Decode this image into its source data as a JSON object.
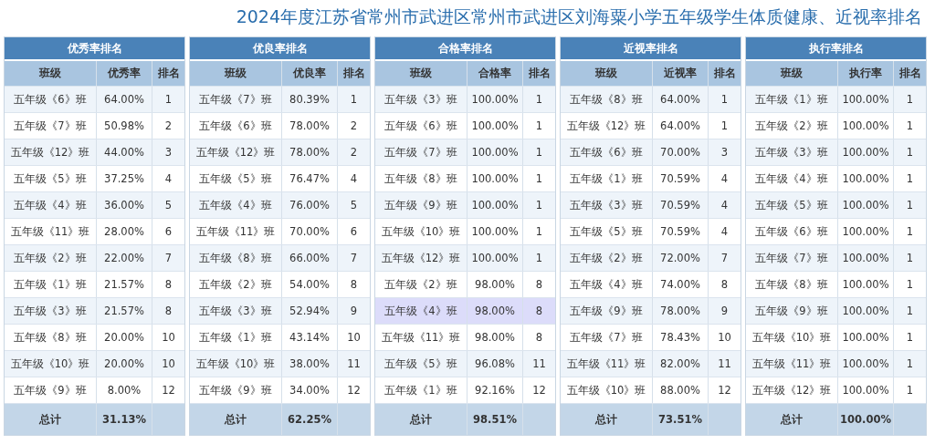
{
  "title": "2024年度江苏省常州市武进区常州市武进区刘海粟小学五年级学生体质健康、近视率排名",
  "tables": [
    {
      "title": "优秀率排名",
      "columns": [
        "班级",
        "优秀率",
        "排名"
      ],
      "rows": [
        {
          "class": "五年级《6》班",
          "rate": "64.00%",
          "rank": "1",
          "selected": false
        },
        {
          "class": "五年级《7》班",
          "rate": "50.98%",
          "rank": "2",
          "selected": false
        },
        {
          "class": "五年级《12》班",
          "rate": "44.00%",
          "rank": "3",
          "selected": false
        },
        {
          "class": "五年级《5》班",
          "rate": "37.25%",
          "rank": "4",
          "selected": false
        },
        {
          "class": "五年级《4》班",
          "rate": "36.00%",
          "rank": "5",
          "selected": false
        },
        {
          "class": "五年级《11》班",
          "rate": "28.00%",
          "rank": "6",
          "selected": false
        },
        {
          "class": "五年级《2》班",
          "rate": "22.00%",
          "rank": "7",
          "selected": false
        },
        {
          "class": "五年级《1》班",
          "rate": "21.57%",
          "rank": "8",
          "selected": false
        },
        {
          "class": "五年级《3》班",
          "rate": "21.57%",
          "rank": "8",
          "selected": false
        },
        {
          "class": "五年级《8》班",
          "rate": "20.00%",
          "rank": "10",
          "selected": false
        },
        {
          "class": "五年级《10》班",
          "rate": "20.00%",
          "rank": "10",
          "selected": false
        },
        {
          "class": "五年级《9》班",
          "rate": "8.00%",
          "rank": "12",
          "selected": false
        }
      ],
      "total": {
        "label": "总计",
        "value": "31.13%"
      }
    },
    {
      "title": "优良率排名",
      "columns": [
        "班级",
        "优良率",
        "排名"
      ],
      "rows": [
        {
          "class": "五年级《7》班",
          "rate": "80.39%",
          "rank": "1",
          "selected": false
        },
        {
          "class": "五年级《6》班",
          "rate": "78.00%",
          "rank": "2",
          "selected": false
        },
        {
          "class": "五年级《12》班",
          "rate": "78.00%",
          "rank": "2",
          "selected": false
        },
        {
          "class": "五年级《5》班",
          "rate": "76.47%",
          "rank": "4",
          "selected": false
        },
        {
          "class": "五年级《4》班",
          "rate": "76.00%",
          "rank": "5",
          "selected": false
        },
        {
          "class": "五年级《11》班",
          "rate": "70.00%",
          "rank": "6",
          "selected": false
        },
        {
          "class": "五年级《8》班",
          "rate": "66.00%",
          "rank": "7",
          "selected": false
        },
        {
          "class": "五年级《2》班",
          "rate": "54.00%",
          "rank": "8",
          "selected": false
        },
        {
          "class": "五年级《3》班",
          "rate": "52.94%",
          "rank": "9",
          "selected": false
        },
        {
          "class": "五年级《1》班",
          "rate": "43.14%",
          "rank": "10",
          "selected": false
        },
        {
          "class": "五年级《10》班",
          "rate": "38.00%",
          "rank": "11",
          "selected": false
        },
        {
          "class": "五年级《9》班",
          "rate": "34.00%",
          "rank": "12",
          "selected": false
        }
      ],
      "total": {
        "label": "总计",
        "value": "62.25%"
      }
    },
    {
      "title": "合格率排名",
      "columns": [
        "班级",
        "合格率",
        "排名"
      ],
      "rows": [
        {
          "class": "五年级《3》班",
          "rate": "100.00%",
          "rank": "1",
          "selected": false
        },
        {
          "class": "五年级《6》班",
          "rate": "100.00%",
          "rank": "1",
          "selected": false
        },
        {
          "class": "五年级《7》班",
          "rate": "100.00%",
          "rank": "1",
          "selected": false
        },
        {
          "class": "五年级《8》班",
          "rate": "100.00%",
          "rank": "1",
          "selected": false
        },
        {
          "class": "五年级《9》班",
          "rate": "100.00%",
          "rank": "1",
          "selected": false
        },
        {
          "class": "五年级《10》班",
          "rate": "100.00%",
          "rank": "1",
          "selected": false
        },
        {
          "class": "五年级《12》班",
          "rate": "100.00%",
          "rank": "1",
          "selected": false
        },
        {
          "class": "五年级《2》班",
          "rate": "98.00%",
          "rank": "8",
          "selected": false
        },
        {
          "class": "五年级《4》班",
          "rate": "98.00%",
          "rank": "8",
          "selected": true
        },
        {
          "class": "五年级《11》班",
          "rate": "98.00%",
          "rank": "8",
          "selected": false
        },
        {
          "class": "五年级《5》班",
          "rate": "96.08%",
          "rank": "11",
          "selected": false
        },
        {
          "class": "五年级《1》班",
          "rate": "92.16%",
          "rank": "12",
          "selected": false
        }
      ],
      "total": {
        "label": "总计",
        "value": "98.51%"
      }
    },
    {
      "title": "近视率排名",
      "columns": [
        "班级",
        "近视率",
        "排名"
      ],
      "rows": [
        {
          "class": "五年级《8》班",
          "rate": "64.00%",
          "rank": "1",
          "selected": false
        },
        {
          "class": "五年级《12》班",
          "rate": "64.00%",
          "rank": "1",
          "selected": false
        },
        {
          "class": "五年级《6》班",
          "rate": "70.00%",
          "rank": "3",
          "selected": false
        },
        {
          "class": "五年级《1》班",
          "rate": "70.59%",
          "rank": "4",
          "selected": false
        },
        {
          "class": "五年级《3》班",
          "rate": "70.59%",
          "rank": "4",
          "selected": false
        },
        {
          "class": "五年级《5》班",
          "rate": "70.59%",
          "rank": "4",
          "selected": false
        },
        {
          "class": "五年级《2》班",
          "rate": "72.00%",
          "rank": "7",
          "selected": false
        },
        {
          "class": "五年级《4》班",
          "rate": "74.00%",
          "rank": "8",
          "selected": false
        },
        {
          "class": "五年级《9》班",
          "rate": "78.00%",
          "rank": "9",
          "selected": false
        },
        {
          "class": "五年级《7》班",
          "rate": "78.43%",
          "rank": "10",
          "selected": false
        },
        {
          "class": "五年级《11》班",
          "rate": "82.00%",
          "rank": "11",
          "selected": false
        },
        {
          "class": "五年级《10》班",
          "rate": "88.00%",
          "rank": "12",
          "selected": false
        }
      ],
      "total": {
        "label": "总计",
        "value": "73.51%"
      }
    },
    {
      "title": "执行率排名",
      "columns": [
        "班级",
        "执行率",
        "排名"
      ],
      "rows": [
        {
          "class": "五年级《1》班",
          "rate": "100.00%",
          "rank": "1",
          "selected": false
        },
        {
          "class": "五年级《2》班",
          "rate": "100.00%",
          "rank": "1",
          "selected": false
        },
        {
          "class": "五年级《3》班",
          "rate": "100.00%",
          "rank": "1",
          "selected": false
        },
        {
          "class": "五年级《4》班",
          "rate": "100.00%",
          "rank": "1",
          "selected": false
        },
        {
          "class": "五年级《5》班",
          "rate": "100.00%",
          "rank": "1",
          "selected": false
        },
        {
          "class": "五年级《6》班",
          "rate": "100.00%",
          "rank": "1",
          "selected": false
        },
        {
          "class": "五年级《7》班",
          "rate": "100.00%",
          "rank": "1",
          "selected": false
        },
        {
          "class": "五年级《8》班",
          "rate": "100.00%",
          "rank": "1",
          "selected": false
        },
        {
          "class": "五年级《9》班",
          "rate": "100.00%",
          "rank": "1",
          "selected": false
        },
        {
          "class": "五年级《10》班",
          "rate": "100.00%",
          "rank": "1",
          "selected": false
        },
        {
          "class": "五年级《11》班",
          "rate": "100.00%",
          "rank": "1",
          "selected": false
        },
        {
          "class": "五年级《12》班",
          "rate": "100.00%",
          "rank": "1",
          "selected": false
        }
      ],
      "total": {
        "label": "总计",
        "value": "100.00%"
      }
    }
  ]
}
